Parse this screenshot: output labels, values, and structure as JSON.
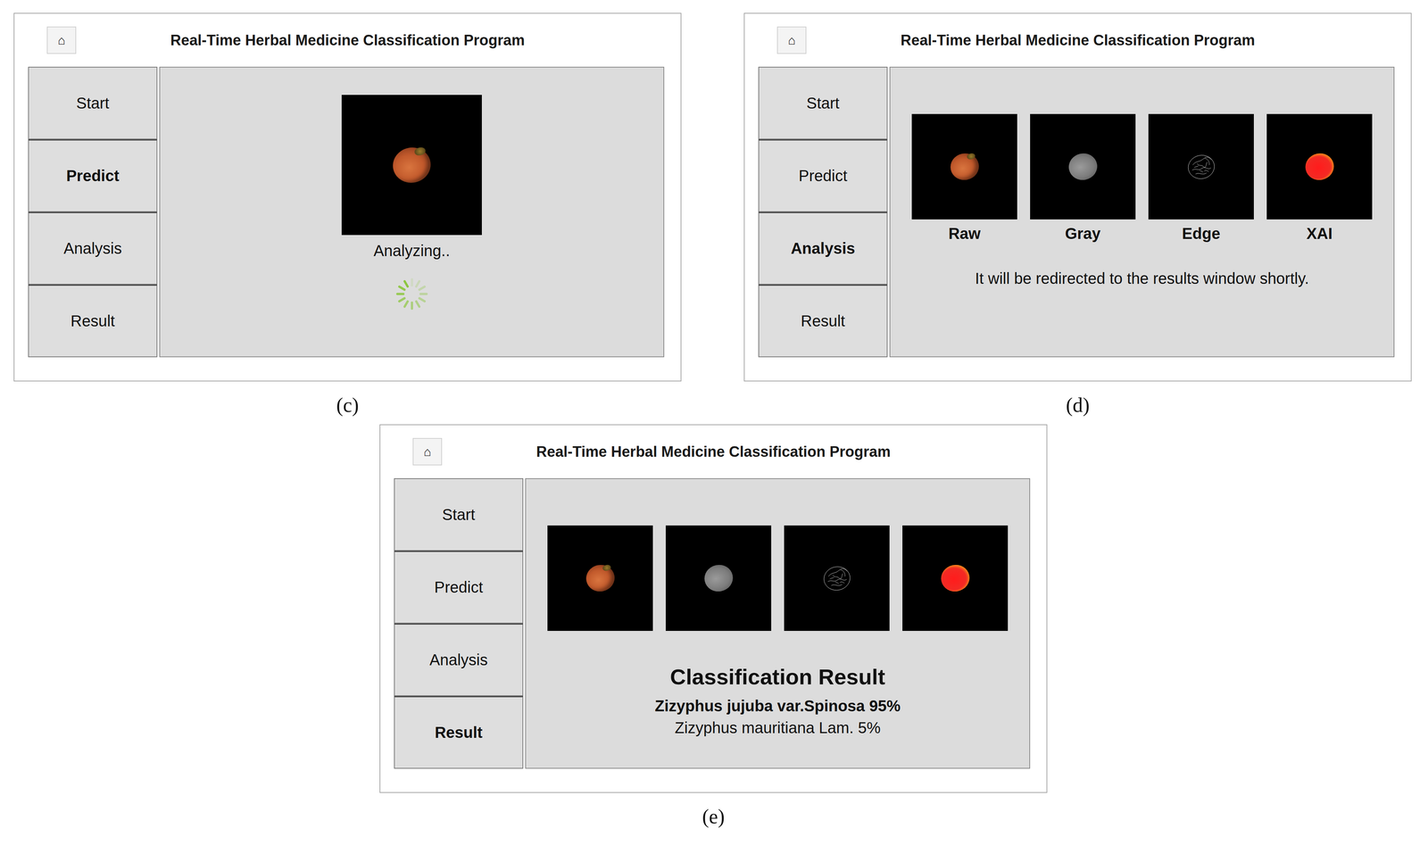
{
  "panels": [
    {
      "caption": "(c)",
      "title": "Real-Time Herbal Medicine Classification Program",
      "home": "⌂",
      "menu": [
        {
          "label": "Start",
          "selected": false
        },
        {
          "label": "Predict",
          "selected": true
        },
        {
          "label": "Analysis",
          "selected": false
        },
        {
          "label": "Result",
          "selected": false
        }
      ],
      "view": "predict",
      "images": [
        {
          "kind": "raw"
        }
      ],
      "status": "Analyzing..",
      "loading": true
    },
    {
      "caption": "(d)",
      "title": "Real-Time Herbal Medicine Classification Program",
      "home": "⌂",
      "menu": [
        {
          "label": "Start",
          "selected": false
        },
        {
          "label": "Predict",
          "selected": false
        },
        {
          "label": "Analysis",
          "selected": true
        },
        {
          "label": "Result",
          "selected": false
        }
      ],
      "view": "analysis",
      "images": [
        {
          "kind": "raw",
          "label": "Raw"
        },
        {
          "kind": "gray",
          "label": "Gray"
        },
        {
          "kind": "edge",
          "label": "Edge"
        },
        {
          "kind": "xai",
          "label": "XAI"
        }
      ],
      "message": "It will be redirected to the results window shortly."
    },
    {
      "caption": "(e)",
      "title": "Real-Time Herbal Medicine Classification Program",
      "home": "⌂",
      "menu": [
        {
          "label": "Start",
          "selected": false
        },
        {
          "label": "Predict",
          "selected": false
        },
        {
          "label": "Analysis",
          "selected": false
        },
        {
          "label": "Result",
          "selected": true
        }
      ],
      "view": "result",
      "images": [
        {
          "kind": "raw"
        },
        {
          "kind": "gray"
        },
        {
          "kind": "edge"
        },
        {
          "kind": "xai"
        }
      ],
      "result_title": "Classification Result",
      "results": [
        {
          "text": "Zizyphus jujuba var.Spinosa 95%",
          "top": true
        },
        {
          "text": "Zizyphus mauritiana Lam. 5%",
          "top": false
        }
      ]
    }
  ]
}
